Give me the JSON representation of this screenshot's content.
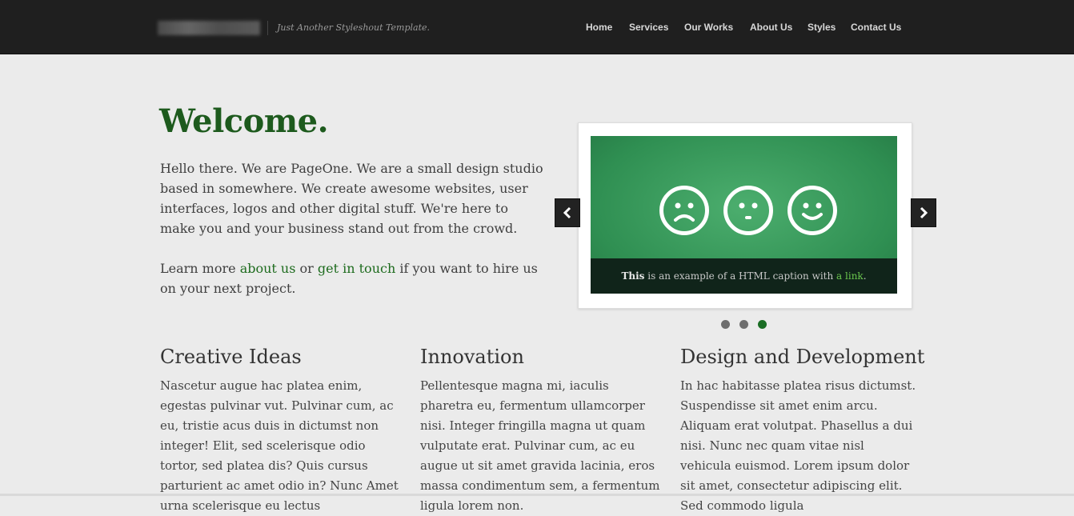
{
  "header": {
    "tagline": "Just Another Styleshout Template.",
    "nav": [
      "Home",
      "Services",
      "Our Works",
      "About Us",
      "Styles",
      "Contact Us"
    ]
  },
  "hero": {
    "title": "Welcome.",
    "intro": "Hello there. We are PageOne. We are a small design studio based in somewhere. We create awesome websites, user interfaces, logos and other digital stuff. We're here to make you and your business stand out from the crowd.",
    "learn_pre": "Learn more ",
    "about_link": "about us",
    "learn_mid": " or ",
    "touch_link": "get in touch",
    "learn_post": " if you want to hire us on your next project."
  },
  "slider": {
    "caption_bold": "This",
    "caption_text": " is an example of a HTML caption with ",
    "caption_link": "a link",
    "caption_end": ".",
    "prev_icon": "chevron-left-icon",
    "next_icon": "chevron-right-icon",
    "dots_count": 3,
    "active_dot": 3,
    "faces": [
      "sad-face-icon",
      "neutral-face-icon",
      "happy-face-icon"
    ]
  },
  "columns": [
    {
      "title": "Creative Ideas",
      "text": "Nascetur augue hac platea enim, egestas pulvinar vut. Pulvinar cum, ac eu, tristie acus duis in dictumst non integer! Elit, sed scelerisque odio tortor, sed platea dis? Quis cursus parturient ac amet odio in? Nunc Amet urna scelerisque eu lectus"
    },
    {
      "title": "Innovation",
      "text": "Pellentesque magna mi, iaculis pharetra eu, fermentum ullamcorper nisi. Integer fringilla magna ut quam vulputate erat. Pulvinar cum, ac eu augue ut sit amet gravida lacinia, eros massa condimentum sem, a fermentum ligula lorem non."
    },
    {
      "title": "Design and Development",
      "text": "In hac habitasse platea risus dictumst. Suspendisse sit amet enim arcu. Aliquam erat volutpat. Phasellus a dui nisi. Nunc nec quam vitae nisl vehicula euismod. Lorem ipsum dolor sit amet, consectetur adipiscing elit. Sed commodo ligula"
    }
  ],
  "colors": {
    "header_bg": "#1f1f1f",
    "accent_green": "#1d5a1d",
    "slide_green": "#2f8f52",
    "link_green": "#6bc84e",
    "page_bg": "#ebebeb"
  }
}
